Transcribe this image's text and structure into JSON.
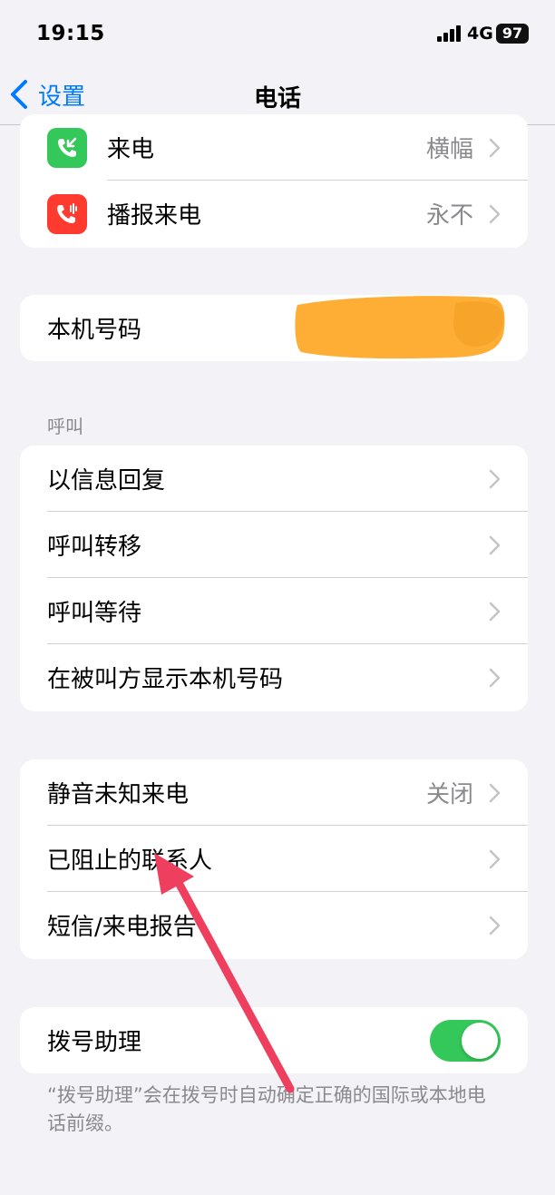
{
  "status_bar": {
    "time": "19:15",
    "network": "4G",
    "battery": "97"
  },
  "nav": {
    "back_label": "设置",
    "title": "电话"
  },
  "group_top": [
    {
      "label": "来电",
      "value": "横幅",
      "icon": "phone-incoming-icon",
      "icon_color": "#34c759"
    },
    {
      "label": "播报来电",
      "value": "永不",
      "icon": "phone-announce-icon",
      "icon_color": "#ff3b30"
    }
  ],
  "my_number": {
    "label": "本机号码"
  },
  "calls_section": {
    "header": "呼叫",
    "items": [
      {
        "label": "以信息回复"
      },
      {
        "label": "呼叫转移"
      },
      {
        "label": "呼叫等待"
      },
      {
        "label": "在被叫方显示本机号码"
      }
    ]
  },
  "blocking_section": {
    "items": [
      {
        "label": "静音未知来电",
        "value": "关闭"
      },
      {
        "label": "已阻止的联系人"
      },
      {
        "label": "短信/来电报告"
      }
    ]
  },
  "dial_assist": {
    "label": "拨号助理",
    "enabled": true,
    "footnote": "“拨号助理”会在拨号时自动确定正确的国际或本地电话前缀。"
  },
  "colors": {
    "accent": "#007aff",
    "toggle_on": "#34c759",
    "annotation_arrow": "#ef3f5e",
    "redaction": "#ffae35"
  }
}
